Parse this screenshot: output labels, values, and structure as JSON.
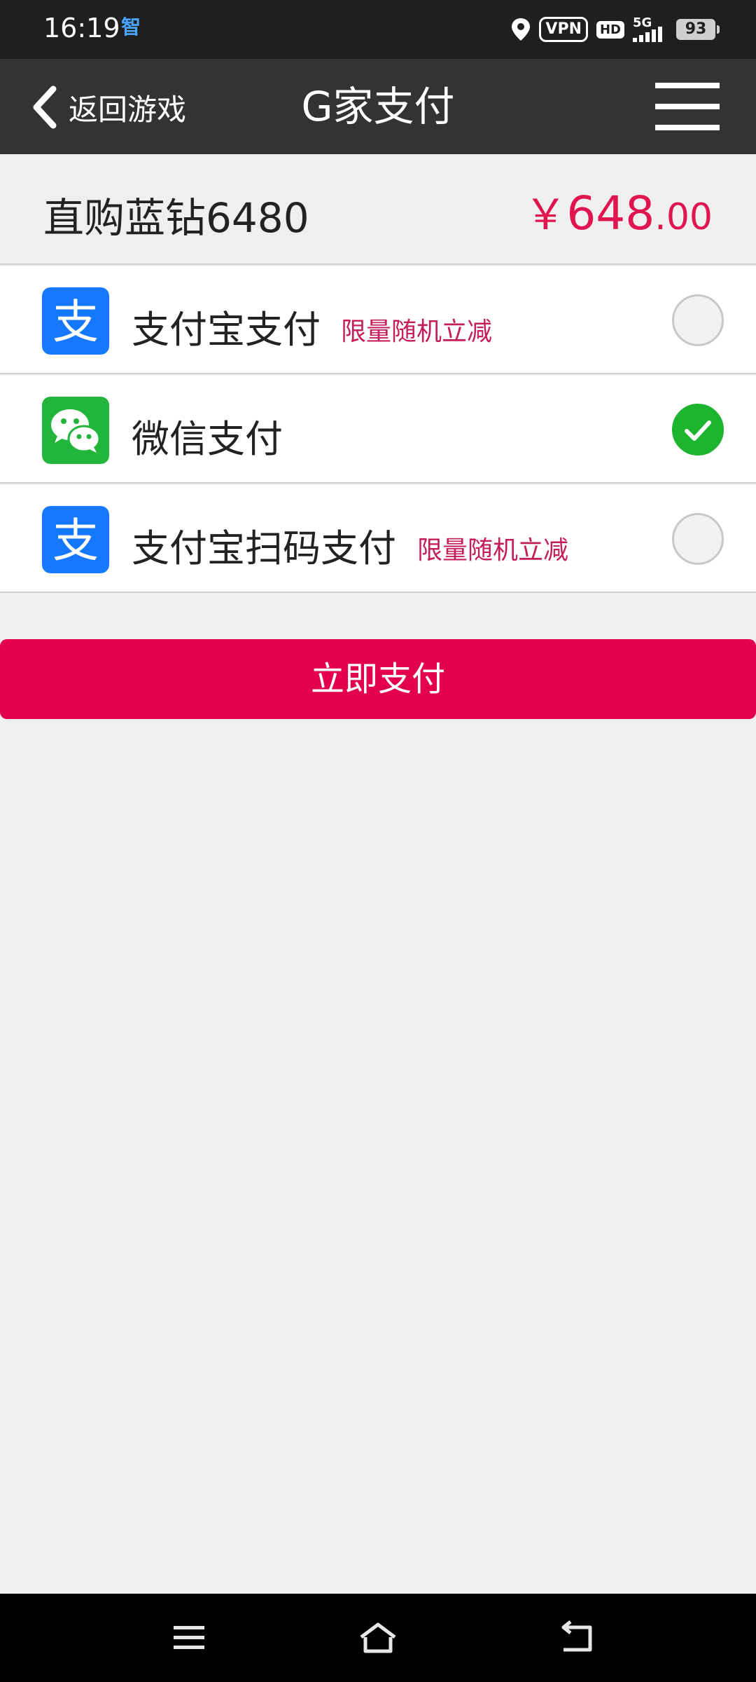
{
  "status_bar": {
    "time": "16:19",
    "app_indicator": "智",
    "vpn": "VPN",
    "hd": "HD",
    "network": "5G",
    "battery": "93"
  },
  "header": {
    "back_label": "返回游戏",
    "title": "G家支付"
  },
  "product": {
    "name": "直购蓝钻6480",
    "price_currency": "￥",
    "price_integer": "648",
    "price_decimal": ".00"
  },
  "payment_options": [
    {
      "label": "支付宝支付",
      "promo": "限量随机立减",
      "icon": "alipay-icon",
      "selected": false
    },
    {
      "label": "微信支付",
      "promo": "",
      "icon": "wechat-icon",
      "selected": true
    },
    {
      "label": "支付宝扫码支付",
      "promo": "限量随机立减",
      "icon": "alipay-icon",
      "selected": false
    }
  ],
  "pay_button": {
    "label": "立即支付"
  },
  "colors": {
    "accent": "#e2004f",
    "price": "#e0144f",
    "promo": "#c41d5a",
    "header_bg": "#333333",
    "selected": "#1db52e",
    "alipay": "#1677ff",
    "wechat": "#22b53b"
  }
}
